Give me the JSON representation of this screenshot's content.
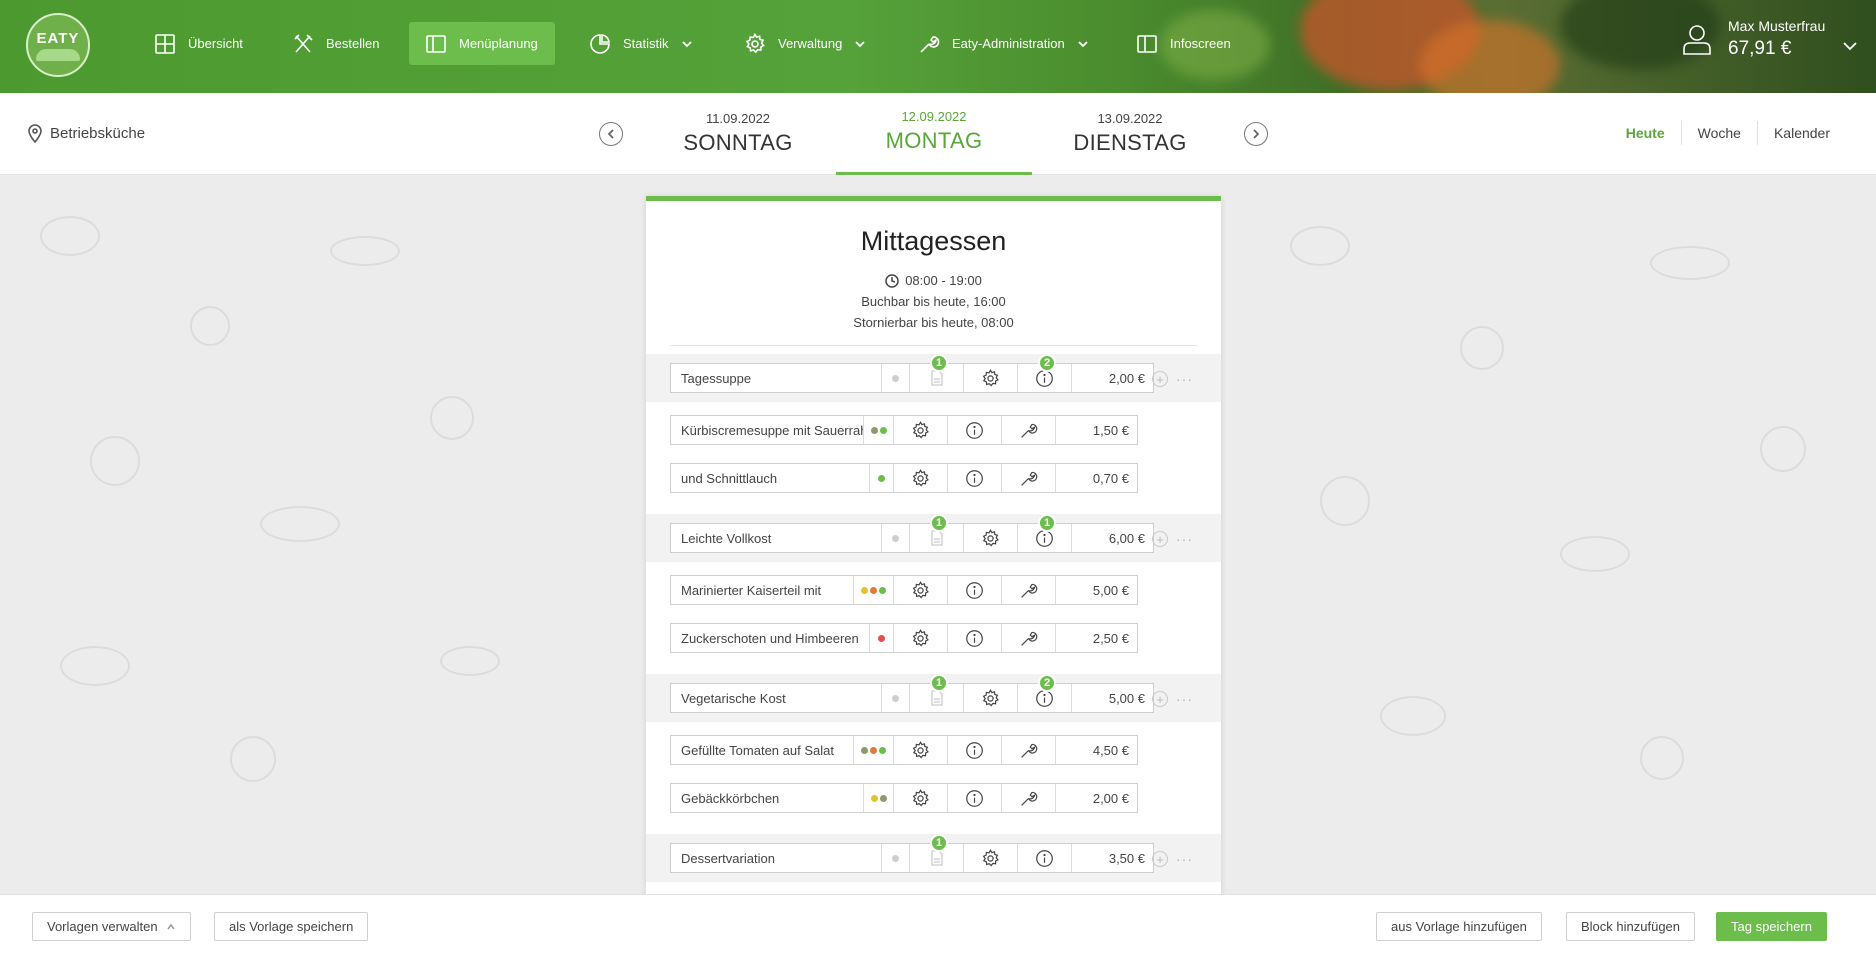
{
  "nav": {
    "logo_text": "EATY",
    "items": [
      {
        "label": "Übersicht",
        "icon": "grid-icon"
      },
      {
        "label": "Bestellen",
        "icon": "cutlery-icon"
      },
      {
        "label": "Menüplanung",
        "icon": "book-icon",
        "active": true
      },
      {
        "label": "Statistik",
        "icon": "pie-chart-icon",
        "dropdown": true
      },
      {
        "label": "Verwaltung",
        "icon": "gear-icon",
        "dropdown": true
      },
      {
        "label": "Eaty-Administration",
        "icon": "wrench-icon",
        "dropdown": true
      },
      {
        "label": "Infoscreen",
        "icon": "screen-icon"
      }
    ],
    "user": {
      "name": "Max Musterfrau",
      "balance": "67,91 €"
    }
  },
  "daybar": {
    "location": "Betriebsküche",
    "days": [
      {
        "date": "11.09.2022",
        "name": "SONNTAG"
      },
      {
        "date": "12.09.2022",
        "name": "MONTAG",
        "active": true
      },
      {
        "date": "13.09.2022",
        "name": "DIENSTAG"
      }
    ],
    "views": [
      "Heute",
      "Woche",
      "Kalender"
    ],
    "active_view": "Heute"
  },
  "card": {
    "title": "Mittagessen",
    "time": "08:00 - 19:00",
    "bookable": "Buchbar bis heute, 16:00",
    "cancelable": "Stornierbar bis heute, 08:00",
    "rows": [
      {
        "type": "group",
        "name": "Tagessuppe",
        "price": "2,00 €",
        "badge_doc": "1",
        "badge_info": "2"
      },
      {
        "type": "item",
        "name": "Kürbiscremesuppe mit Sauerrahm",
        "price": "1,50 €",
        "dots": [
          "#8a9a6e",
          "#6cbd4c"
        ]
      },
      {
        "type": "item",
        "name": "und Schnittlauch",
        "price": "0,70 €",
        "dots": [
          "#6cbd4c"
        ]
      },
      {
        "type": "group",
        "name": "Leichte Vollkost",
        "price": "6,00 €",
        "badge_doc": "1",
        "badge_info": "1"
      },
      {
        "type": "item",
        "name": "Marinierter Kaiserteil mit",
        "price": "5,00 €",
        "dots": [
          "#e2c233",
          "#e07a3a",
          "#6cbd4c"
        ]
      },
      {
        "type": "item",
        "name": "Zuckerschoten und Himbeeren",
        "price": "2,50 €",
        "dots": [
          "#e45050"
        ]
      },
      {
        "type": "group",
        "name": "Vegetarische Kost",
        "price": "5,00 €",
        "badge_doc": "1",
        "badge_info": "2"
      },
      {
        "type": "item",
        "name": "Gefüllte Tomaten auf Salat",
        "price": "4,50 €",
        "dots": [
          "#8a9a6e",
          "#e07a3a",
          "#6cbd4c"
        ]
      },
      {
        "type": "item",
        "name": "Gebäckkörbchen",
        "price": "2,00 €",
        "dots": [
          "#e2c233",
          "#8a9a6e"
        ]
      },
      {
        "type": "group",
        "name": "Dessertvariation",
        "price": "3,50 €",
        "badge_doc": "1"
      }
    ]
  },
  "bottom": {
    "manage_templates": "Vorlagen verwalten",
    "save_as_template": "als Vorlage speichern",
    "add_from_template": "aus Vorlage hinzufügen",
    "add_block": "Block hinzufügen",
    "save_day": "Tag speichern"
  },
  "colors": {
    "accent": "#6cbd4c",
    "accent_text": "#5aa638"
  }
}
